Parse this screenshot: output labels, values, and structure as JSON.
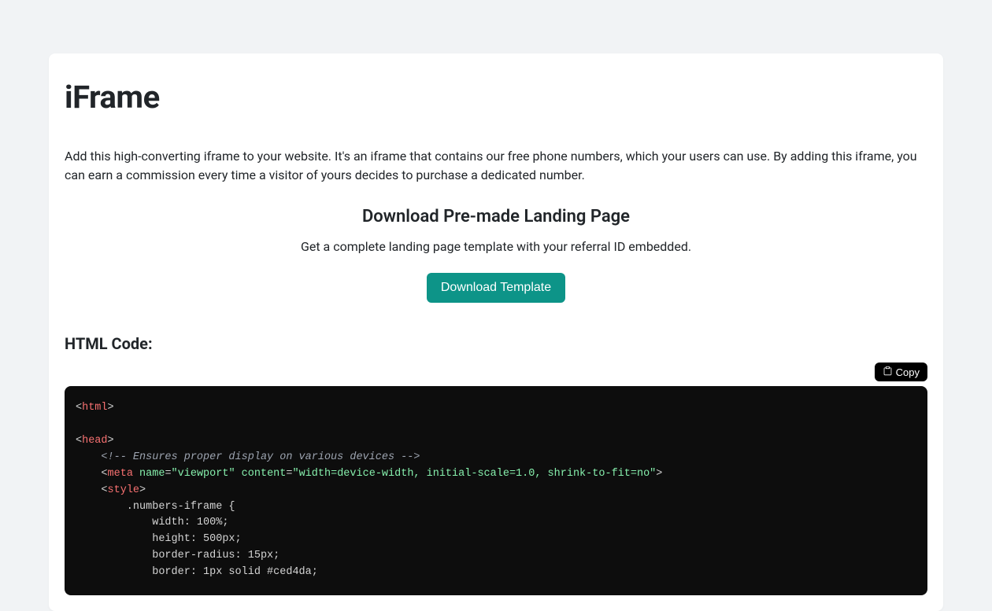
{
  "title": "iFrame",
  "intro": "Add this high-converting iframe to your website. It's an iframe that contains our free phone numbers, which your users can use. By adding this iframe, you can earn a commission every time a visitor of yours decides to purchase a dedicated number.",
  "download": {
    "heading": "Download Pre-made Landing Page",
    "description": "Get a complete landing page template with your referral ID embedded.",
    "button_label": "Download Template"
  },
  "code_section": {
    "label": "HTML Code:",
    "copy_label": "Copy"
  },
  "code": {
    "l1_open": "<",
    "l1_tag": "html",
    "l1_close": ">",
    "l3_open": "<",
    "l3_tag": "head",
    "l3_close": ">",
    "l4_comment": "<!-- Ensures proper display on various devices -->",
    "l5_open": "<",
    "l5_tag": "meta",
    "l5_sp1": " ",
    "l5_attr1": "name",
    "l5_eq1": "=",
    "l5_val1": "\"viewport\"",
    "l5_sp2": " ",
    "l5_attr2": "content",
    "l5_eq2": "=",
    "l5_val2": "\"width=device-width, initial-scale=1.0, shrink-to-fit=no\"",
    "l5_close": ">",
    "l6_open": "<",
    "l6_tag": "style",
    "l6_close": ">",
    "l7": "        .numbers-iframe {",
    "l8": "            width: 100%;",
    "l9": "            height: 500px;",
    "l10": "            border-radius: 15px;",
    "l11": "            border: 1px solid #ced4da;"
  }
}
